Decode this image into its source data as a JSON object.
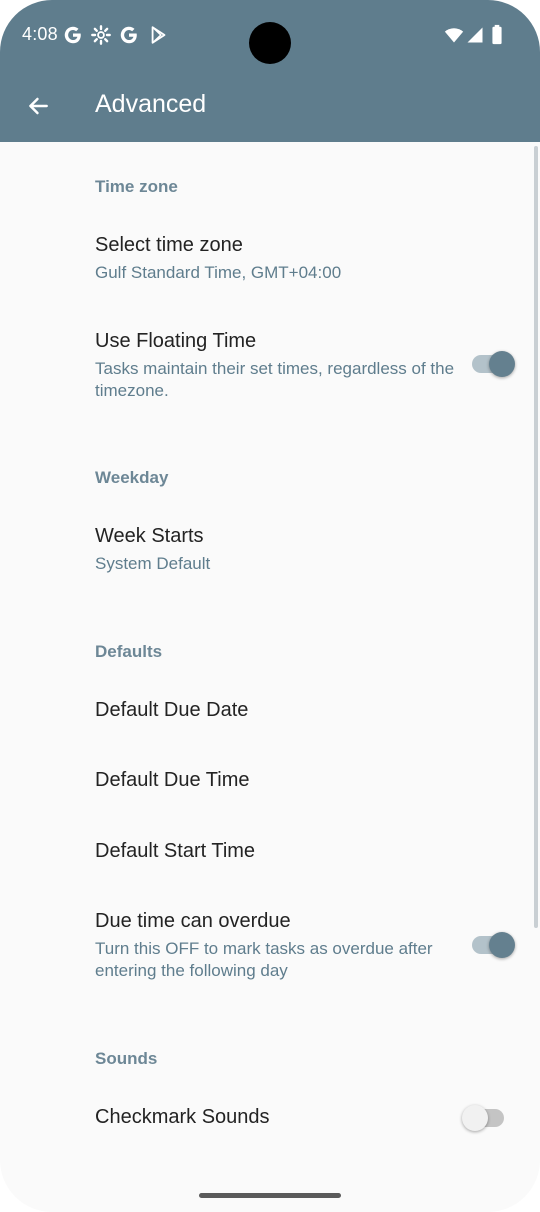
{
  "status_bar": {
    "time": "4:08",
    "icons": [
      "google-icon",
      "settings-icon",
      "google-icon",
      "play-store-icon",
      "wifi-icon",
      "signal-icon",
      "battery-icon"
    ]
  },
  "app_bar": {
    "title": "Advanced",
    "back_icon": "arrow-left-icon",
    "color": "#5f7d8d"
  },
  "sections": {
    "time_zone": {
      "header": "Time zone",
      "select_time_zone": {
        "title": "Select time zone",
        "summary": "Gulf Standard Time, GMT+04:00"
      },
      "floating_time": {
        "title": "Use Floating Time",
        "summary": "Tasks maintain their set times, regardless of the timezone.",
        "enabled": true
      }
    },
    "weekday": {
      "header": "Weekday",
      "week_starts": {
        "title": "Week Starts",
        "summary": "System Default"
      }
    },
    "defaults": {
      "header": "Defaults",
      "default_due_date": {
        "title": "Default Due Date"
      },
      "default_due_time": {
        "title": "Default Due Time"
      },
      "default_start_time": {
        "title": "Default Start Time"
      },
      "due_overdue": {
        "title": "Due time can overdue",
        "summary": "Turn this OFF to mark tasks as overdue after entering the following day",
        "enabled": true
      }
    },
    "sounds": {
      "header": "Sounds",
      "checkmark_sounds": {
        "title": "Checkmark Sounds",
        "enabled": false
      }
    }
  },
  "colors": {
    "accent": "#5f7d8d",
    "section_header": "#6d8796",
    "background": "#fafafa"
  }
}
